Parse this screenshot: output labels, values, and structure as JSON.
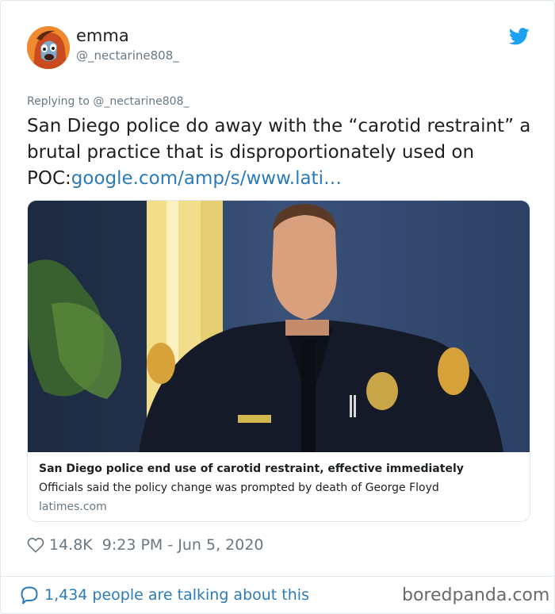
{
  "author": {
    "name": "emma",
    "handle": "@_nectarine808_"
  },
  "icons": {
    "brand": "twitter-bird-icon",
    "like": "heart-icon",
    "reply": "speech-bubble-icon"
  },
  "tweet": {
    "replying_to": "Replying to @_nectarine808_",
    "text": "San Diego police do away with the “carotid restraint” a brutal practice that is disproportionately used on POC:",
    "link_text": "google.com/amp/s/www.lati…"
  },
  "link_card": {
    "title": "San Diego police end use of carotid restraint, effective immediately",
    "description": "Officials said the policy change was prompted by death of George Floyd",
    "domain": "latimes.com"
  },
  "stats": {
    "likes": "14.8K",
    "timestamp": "9:23 PM - Jun 5, 2020"
  },
  "footer": {
    "talking": "1,434 people are talking about this",
    "watermark": "boredpanda.com"
  },
  "colors": {
    "link_blue": "#2b7bb9",
    "twitter_blue": "#1da1f2",
    "muted_gray": "#697882",
    "border": "#e1e8ed"
  }
}
